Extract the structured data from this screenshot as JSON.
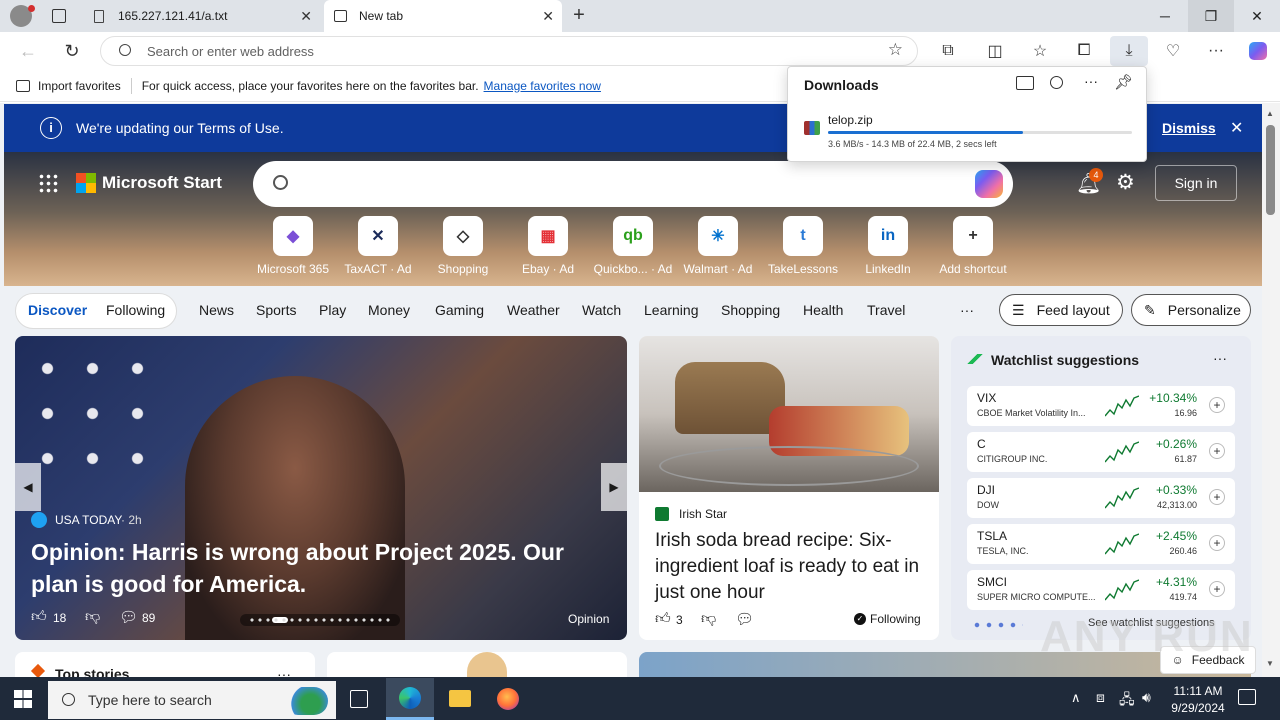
{
  "tabs": [
    {
      "title": "165.227.121.41/a.txt"
    },
    {
      "title": "New tab"
    }
  ],
  "address": {
    "placeholder": "Search or enter web address"
  },
  "favorites": {
    "import_label": "Import favorites",
    "message": "For quick access, place your favorites here on the favorites bar.",
    "manage_link": "Manage favorites now"
  },
  "downloads": {
    "title": "Downloads",
    "file": "telop.zip",
    "status": "3.6 MB/s - 14.3 MB of 22.4 MB, 2 secs left",
    "progress": 0.64
  },
  "terms": {
    "message": "We're updating our Terms of Use.",
    "dismiss": "Dismiss"
  },
  "brand": {
    "name": "Microsoft Start"
  },
  "notifications": {
    "count": "4"
  },
  "signin": {
    "label": "Sign in"
  },
  "shortcuts": [
    {
      "label": "Microsoft 365",
      "glyph": "◆",
      "color": "#7b4fd6"
    },
    {
      "label": "TaxACT · Ad",
      "glyph": "✕",
      "color": "#1b2b5a"
    },
    {
      "label": "Shopping",
      "glyph": "◇",
      "color": "#333333"
    },
    {
      "label": "Ebay · Ad",
      "glyph": "▦",
      "color": "#e43137"
    },
    {
      "label": "Quickbo... · Ad",
      "glyph": "qb",
      "color": "#2ca01c"
    },
    {
      "label": "Walmart · Ad",
      "glyph": "✳",
      "color": "#0071ce"
    },
    {
      "label": "TakeLessons",
      "glyph": "t",
      "color": "#2b7bd6"
    },
    {
      "label": "LinkedIn",
      "glyph": "in",
      "color": "#0a66c2"
    },
    {
      "label": "Add shortcut",
      "glyph": "+",
      "color": "#333333"
    }
  ],
  "nav": {
    "discover": "Discover",
    "following": "Following",
    "items": [
      "News",
      "Sports",
      "Play",
      "Money",
      "Gaming",
      "Weather",
      "Watch",
      "Learning",
      "Shopping",
      "Health",
      "Travel"
    ],
    "more": "···",
    "feed_layout": "Feed layout",
    "personalize": "Personalize"
  },
  "main_story": {
    "source": "USA TODAY",
    "age": "· 2h",
    "headline": "Opinion: Harris is wrong about Project 2025. Our plan is good for America.",
    "likes": "18",
    "comments": "89",
    "tag": "Opinion"
  },
  "food_story": {
    "source": "Irish Star",
    "headline": "Irish soda bread recipe: Six-ingredient loaf is ready to eat in just one hour",
    "likes": "3",
    "following": "Following"
  },
  "watchlist": {
    "title": "Watchlist suggestions",
    "more": "···",
    "stocks": [
      {
        "ticker": "VIX",
        "name": "CBOE Market Volatility In...",
        "change": "+10.34%",
        "price": "16.96"
      },
      {
        "ticker": "C",
        "name": "CITIGROUP INC.",
        "change": "+0.26%",
        "price": "61.87"
      },
      {
        "ticker": "DJI",
        "name": "DOW",
        "change": "+0.33%",
        "price": "42,313.00"
      },
      {
        "ticker": "TSLA",
        "name": "TESLA, INC.",
        "change": "+2.45%",
        "price": "260.46"
      },
      {
        "ticker": "SMCI",
        "name": "SUPER MICRO COMPUTE...",
        "change": "+4.31%",
        "price": "419.74"
      }
    ],
    "see_more": "See watchlist suggestions"
  },
  "lower": {
    "top_stories": "Top stories",
    "more": "···"
  },
  "feedback": {
    "label": "Feedback"
  },
  "taskbar": {
    "search_placeholder": "Type here to search",
    "time": "11:11 AM",
    "date": "9/29/2024"
  },
  "watermark": "ANY RUN"
}
